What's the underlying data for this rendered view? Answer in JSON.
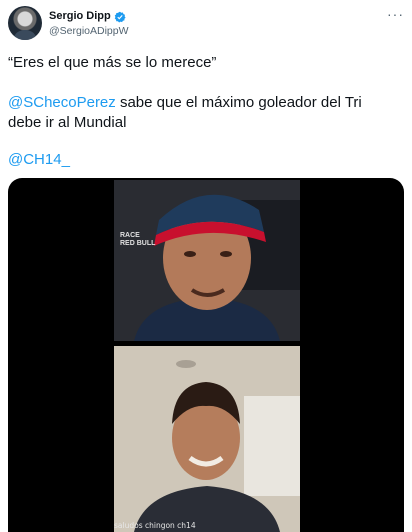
{
  "tweet": {
    "author_name": "Sergio Dipp",
    "author_handle": "@SergioADippW",
    "line1": "“Eres el que más se lo merece”",
    "mention1": "@SChecoPerez",
    "line2_rest": " sabe que el máximo goleador del Tri",
    "line3": "debe ir al Mundial",
    "mention2": "@CH14_"
  },
  "media": {
    "sponsor_text": "RACE\nRED BULL",
    "caption": "saludos chingon ch14"
  },
  "colors": {
    "link": "#1d9bf0",
    "verified": "#1d9bf0",
    "secondary_text": "#536471"
  },
  "icons": {
    "verified": "verified-badge-icon",
    "more": "more-options-icon"
  }
}
